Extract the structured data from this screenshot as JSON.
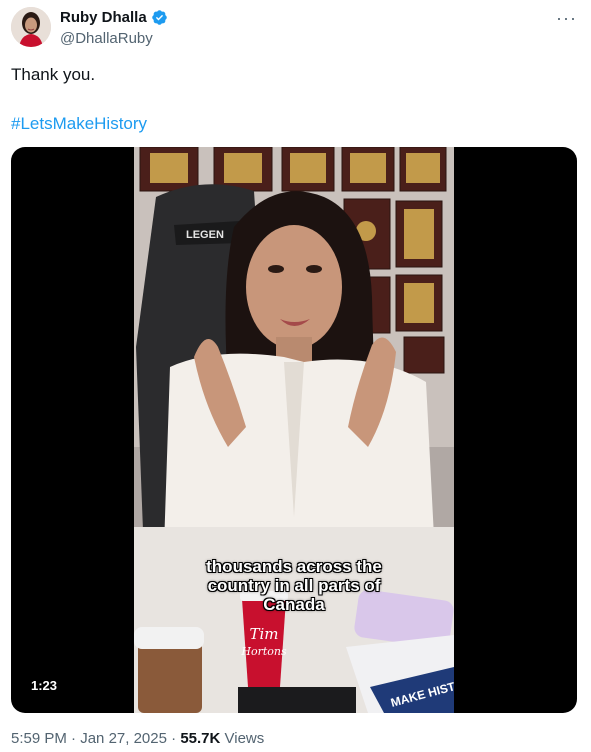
{
  "author": {
    "name": "Ruby Dhalla",
    "handle": "@DhallaRuby",
    "verified": true
  },
  "tweet": {
    "text": "Thank you.",
    "hashtag": "#LetsMakeHistory"
  },
  "media": {
    "duration": "1:23",
    "caption_lines": [
      "thousands across the",
      "country in all parts of",
      "Canada"
    ],
    "chair_brand": "LEGEN",
    "cup_brand_line1": "Tim",
    "cup_brand_line2": "Hortons",
    "newspaper_text": "MAKE HISTORY"
  },
  "meta": {
    "time": "5:59 PM",
    "separator1": " · ",
    "date": "Jan 27, 2025",
    "separator2": " · ",
    "views_count": "55.7K",
    "views_label": " Views"
  },
  "icons": {
    "verified": "verified-badge-icon",
    "more": "more-options-icon"
  },
  "colors": {
    "link": "#1d9bf0",
    "secondary_text": "#536471",
    "primary_text": "#0f1419"
  }
}
